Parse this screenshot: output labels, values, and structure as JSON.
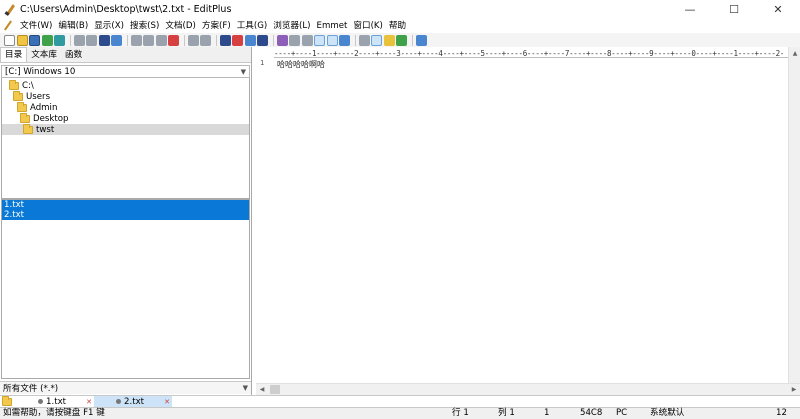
{
  "window": {
    "title": "C:\\Users\\Admin\\Desktop\\twst\\2.txt - EditPlus",
    "minimize_glyph": "—",
    "maximize_glyph": "☐",
    "close_glyph": "✕"
  },
  "menu": {
    "items": [
      "文件(W)",
      "编辑(B)",
      "显示(X)",
      "搜索(S)",
      "文档(D)",
      "方案(F)",
      "工具(G)",
      "浏览器(L)",
      "Emmet",
      "窗口(K)",
      "帮助"
    ]
  },
  "left_panel": {
    "tabs": [
      "目录",
      "文本库",
      "函数"
    ],
    "drive": "[C:] Windows 10",
    "tree": [
      {
        "label": "C:\\",
        "indent": 0,
        "selected": false
      },
      {
        "label": "Users",
        "indent": 1,
        "selected": false
      },
      {
        "label": "Admin",
        "indent": 2,
        "selected": false
      },
      {
        "label": "Desktop",
        "indent": 3,
        "selected": false
      },
      {
        "label": "twst",
        "indent": 4,
        "selected": true
      }
    ],
    "files": [
      "1.txt",
      "2.txt"
    ],
    "filter": "所有文件 (*.*)"
  },
  "editor": {
    "ruler": "----+----1----+----2----+----3----+----4----+----5----+----6----+----7----+----8----+----9----+----0----+----1----+----2-",
    "line_number": "1",
    "line_text": "哈哈哈哈啊哈"
  },
  "doc_tabs": [
    {
      "label": "1.txt",
      "active": false
    },
    {
      "label": "2.txt",
      "active": true
    }
  ],
  "status": {
    "help": "如需帮助，请按键盘 F1 键",
    "line": "行 1",
    "col": "列 1",
    "sel": "1",
    "code": "54C8",
    "eol": "PC",
    "encoding": "系统默认",
    "size": "12"
  },
  "colors": {
    "selection_blue": "#0a78d7",
    "active_tab": "#cde3f7",
    "tree_selected": "#d9d9d9"
  }
}
